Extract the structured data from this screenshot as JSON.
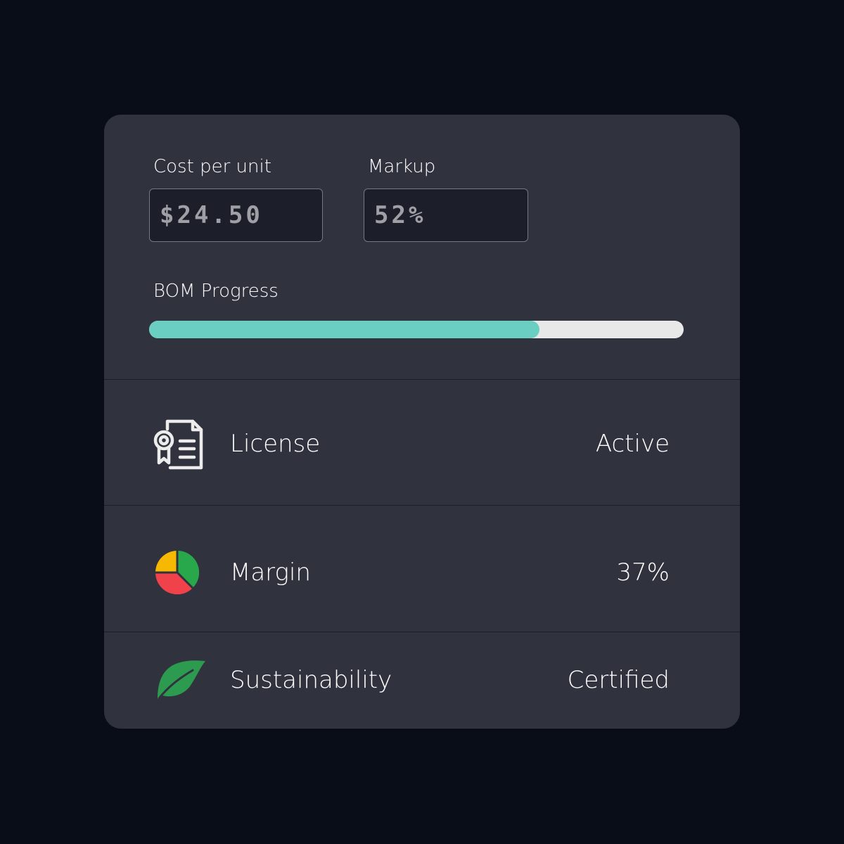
{
  "colors": {
    "background": "#090d18",
    "card": "#30323e",
    "input_bg": "#1c1e2a",
    "progress_fill": "#6acfc2",
    "progress_track": "#e8e8e8",
    "pie_yellow": "#f6b800",
    "pie_green": "#28a84b",
    "pie_red": "#f0424a",
    "leaf_green": "#2c9b4f"
  },
  "fields": {
    "cost": {
      "label": "Cost per unit",
      "value": "$24.50"
    },
    "markup": {
      "label": "Markup",
      "value": "52%"
    }
  },
  "progress": {
    "label": "BOM Progress",
    "value": 0.73
  },
  "rows": [
    {
      "label": "License",
      "value": "Active",
      "icon": "license-certificate-icon"
    },
    {
      "label": "Margin",
      "value": "37%",
      "icon": "pie-chart-icon"
    },
    {
      "label": "Sustainability",
      "value": "Certified",
      "icon": "leaf-icon"
    }
  ]
}
